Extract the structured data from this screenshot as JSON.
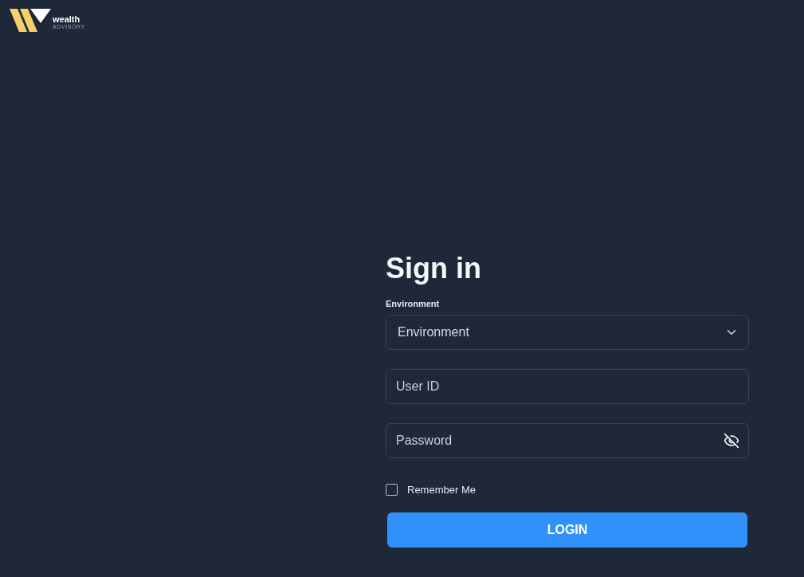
{
  "logo": {
    "name": "wealth",
    "tagline": "ADVISORY"
  },
  "form": {
    "title": "Sign in",
    "environment": {
      "label": "Environment",
      "value": "Environment"
    },
    "user_id": {
      "placeholder": "User ID"
    },
    "password": {
      "placeholder": "Password"
    },
    "remember": {
      "label": "Remember Me",
      "checked": false
    },
    "submit": "LOGIN"
  }
}
